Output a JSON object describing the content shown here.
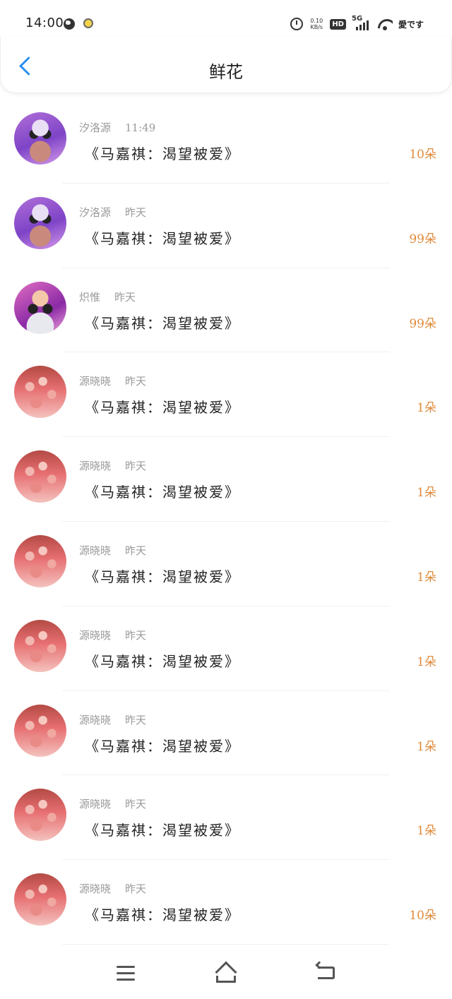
{
  "status_bar": {
    "time": "14:00",
    "network_speed_value": "0.10",
    "network_speed_unit": "KB/s",
    "hd_label": "HD",
    "signal_label": "5G",
    "carrier": "愛です"
  },
  "header": {
    "title": "鲜花"
  },
  "list": {
    "items": [
      {
        "name": "汐洛源",
        "time": "11:49",
        "message": "《马嘉祺：渴望被爱》",
        "count": "10朵",
        "avatar": "purple"
      },
      {
        "name": "汐洛源",
        "time": "昨天",
        "message": "《马嘉祺：渴望被爱》",
        "count": "99朵",
        "avatar": "purple"
      },
      {
        "name": "炽惟",
        "time": "昨天",
        "message": "《马嘉祺：渴望被爱》",
        "count": "99朵",
        "avatar": "pinkface"
      },
      {
        "name": "源晓晓",
        "time": "昨天",
        "message": "《马嘉祺：渴望被爱》",
        "count": "1朵",
        "avatar": "crowd"
      },
      {
        "name": "源晓晓",
        "time": "昨天",
        "message": "《马嘉祺：渴望被爱》",
        "count": "1朵",
        "avatar": "crowd"
      },
      {
        "name": "源晓晓",
        "time": "昨天",
        "message": "《马嘉祺：渴望被爱》",
        "count": "1朵",
        "avatar": "crowd"
      },
      {
        "name": "源晓晓",
        "time": "昨天",
        "message": "《马嘉祺：渴望被爱》",
        "count": "1朵",
        "avatar": "crowd"
      },
      {
        "name": "源晓晓",
        "time": "昨天",
        "message": "《马嘉祺：渴望被爱》",
        "count": "1朵",
        "avatar": "crowd"
      },
      {
        "name": "源晓晓",
        "time": "昨天",
        "message": "《马嘉祺：渴望被爱》",
        "count": "1朵",
        "avatar": "crowd"
      },
      {
        "name": "源晓晓",
        "time": "昨天",
        "message": "《马嘉祺：渴望被爱》",
        "count": "10朵",
        "avatar": "crowd"
      }
    ]
  },
  "icons": {
    "back": "chevron-left-icon",
    "menu": "menu-icon",
    "home": "home-icon",
    "return": "return-icon"
  },
  "colors": {
    "accent": "#2a8ff0",
    "count": "#e08b3c",
    "meta_text": "#9a9a9a"
  }
}
